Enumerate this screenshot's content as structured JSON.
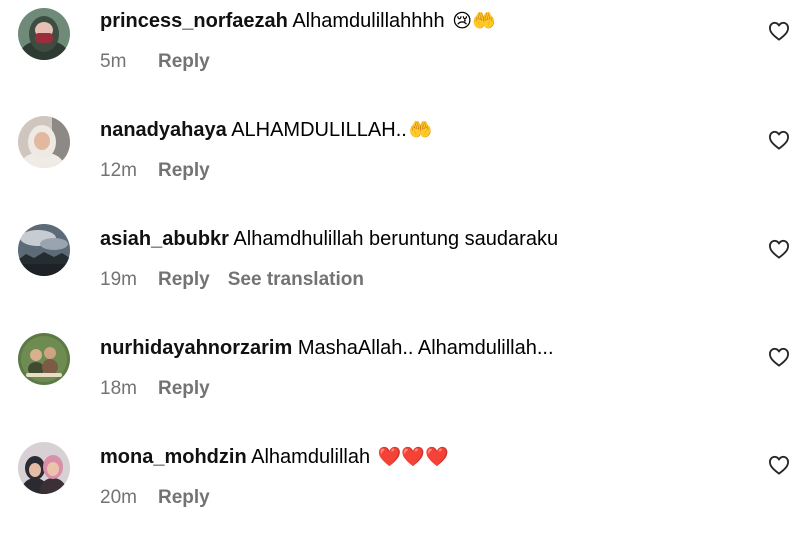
{
  "comments": [
    {
      "username": "princess_norfaezah",
      "text": "Alhamdulillahhhh",
      "emoji": "😢🤲",
      "time": "5m",
      "reply_label": "Reply",
      "translate_label": "",
      "avatar_icon": "hijab-face-avatar",
      "avatar_color": "#5a6b5e"
    },
    {
      "username": "nanadyahaya",
      "text": "ALHAMDULILLAH..",
      "emoji": "🤲",
      "time": "12m",
      "reply_label": "Reply",
      "translate_label": "",
      "avatar_icon": "hijab-portrait-avatar",
      "avatar_color": "#d9cfc6"
    },
    {
      "username": "asiah_abubkr",
      "text": "Alhamdhulillah beruntung saudaraku",
      "emoji": "",
      "time": "19m",
      "reply_label": "Reply",
      "translate_label": "See translation",
      "avatar_icon": "cloudy-sky-avatar",
      "avatar_color": "#3c4652"
    },
    {
      "username": "nurhidayahnorzarim",
      "text": "MashaAllah.. Alhamdulillah...",
      "emoji": "",
      "time": "18m",
      "reply_label": "Reply",
      "translate_label": "",
      "avatar_icon": "group-photo-avatar",
      "avatar_color": "#4f6a3d"
    },
    {
      "username": "mona_mohdzin",
      "text": "Alhamdulillah",
      "emoji": "❤️❤️❤️",
      "time": "20m",
      "reply_label": "Reply",
      "translate_label": "",
      "avatar_icon": "two-people-avatar",
      "avatar_color": "#c9c2c8"
    }
  ]
}
